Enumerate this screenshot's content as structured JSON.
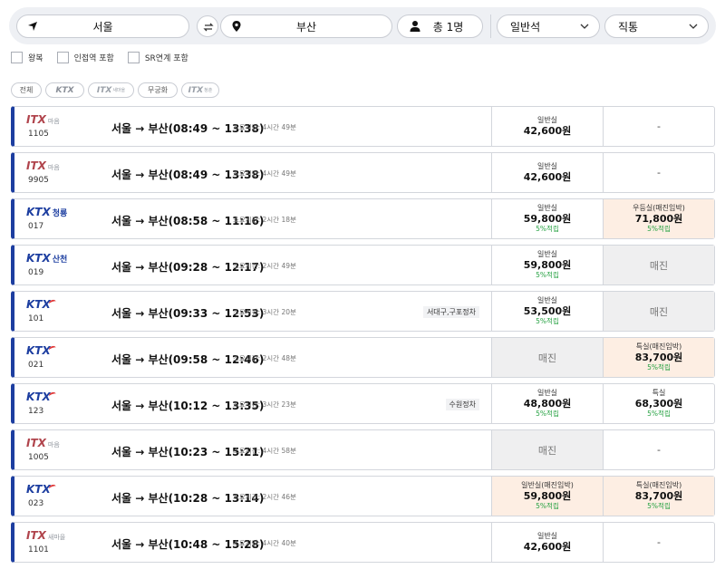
{
  "search": {
    "origin": "서울",
    "destination": "부산",
    "passengers": "총 1명",
    "seat_class": "일반석",
    "route_type": "직통"
  },
  "options": [
    {
      "label": "왕복"
    },
    {
      "label": "인접역 포함"
    },
    {
      "label": "SR연계 포함"
    }
  ],
  "filters": {
    "all": "전체",
    "ktx": "KTX",
    "itx_saemaeul_main": "ITX",
    "itx_saemaeul_sub": "새마을",
    "mugunghwa": "무궁화",
    "itx_cheongchun_main": "ITX",
    "itx_cheongchun_sub": "청춘"
  },
  "trains": [
    {
      "brand": "ITX",
      "brand_sub": "마음",
      "number": "1105",
      "route": "서울 → 부산(08:49 ~ 13:38)",
      "duration": "소요시간: 4시간 49분",
      "stop": "",
      "seat1": {
        "cls": "일반실",
        "price": "42,600원",
        "points": "",
        "status": "available"
      },
      "seat2": {
        "cls": "",
        "price": "",
        "points": "",
        "status": "none",
        "text": "-"
      }
    },
    {
      "brand": "ITX",
      "brand_sub": "마음",
      "number": "9905",
      "route": "서울 → 부산(08:49 ~ 13:38)",
      "duration": "소요시간: 4시간 49분",
      "stop": "",
      "seat1": {
        "cls": "일반실",
        "price": "42,600원",
        "points": "",
        "status": "available"
      },
      "seat2": {
        "cls": "",
        "price": "",
        "points": "",
        "status": "none",
        "text": "-"
      }
    },
    {
      "brand": "KTX",
      "brand_sub": "청룡",
      "number": "017",
      "route": "서울 → 부산(08:58 ~ 11:16)",
      "duration": "소요시간: 2시간 18분",
      "stop": "",
      "seat1": {
        "cls": "일반실",
        "price": "59,800원",
        "points": "5%적립",
        "status": "available"
      },
      "seat2": {
        "cls": "우등실(매진임박)",
        "price": "71,800원",
        "points": "5%적립",
        "status": "imminent"
      }
    },
    {
      "brand": "KTX",
      "brand_sub": "산천",
      "number": "019",
      "route": "서울 → 부산(09:28 ~ 12:17)",
      "duration": "소요시간: 2시간 49분",
      "stop": "",
      "seat1": {
        "cls": "일반실",
        "price": "59,800원",
        "points": "5%적립",
        "status": "available"
      },
      "seat2": {
        "cls": "",
        "price": "",
        "points": "",
        "status": "soldout",
        "text": "매진"
      }
    },
    {
      "brand": "KTX",
      "brand_sub": "",
      "number": "101",
      "route": "서울 → 부산(09:33 ~ 12:53)",
      "duration": "소요시간: 3시간 20분",
      "stop": "서대구,구포정차",
      "seat1": {
        "cls": "일반실",
        "price": "53,500원",
        "points": "5%적립",
        "status": "available"
      },
      "seat2": {
        "cls": "",
        "price": "",
        "points": "",
        "status": "soldout",
        "text": "매진"
      }
    },
    {
      "brand": "KTX",
      "brand_sub": "",
      "number": "021",
      "route": "서울 → 부산(09:58 ~ 12:46)",
      "duration": "소요시간: 2시간 48분",
      "stop": "",
      "seat1": {
        "cls": "",
        "price": "",
        "points": "",
        "status": "soldout",
        "text": "매진"
      },
      "seat2": {
        "cls": "특실(매진임박)",
        "price": "83,700원",
        "points": "5%적립",
        "status": "imminent"
      }
    },
    {
      "brand": "KTX",
      "brand_sub": "",
      "number": "123",
      "route": "서울 → 부산(10:12 ~ 13:35)",
      "duration": "소요시간: 3시간 23분",
      "stop": "수원정차",
      "seat1": {
        "cls": "일반실",
        "price": "48,800원",
        "points": "5%적립",
        "status": "available"
      },
      "seat2": {
        "cls": "특실",
        "price": "68,300원",
        "points": "5%적립",
        "status": "available"
      }
    },
    {
      "brand": "ITX",
      "brand_sub": "마음",
      "number": "1005",
      "route": "서울 → 부산(10:23 ~ 15:21)",
      "duration": "소요시간: 4시간 58분",
      "stop": "",
      "seat1": {
        "cls": "",
        "price": "",
        "points": "",
        "status": "soldout",
        "text": "매진"
      },
      "seat2": {
        "cls": "",
        "price": "",
        "points": "",
        "status": "none",
        "text": "-"
      }
    },
    {
      "brand": "KTX",
      "brand_sub": "",
      "number": "023",
      "route": "서울 → 부산(10:28 ~ 13:14)",
      "duration": "소요시간: 2시간 46분",
      "stop": "",
      "seat1": {
        "cls": "일반실(매진임박)",
        "price": "59,800원",
        "points": "5%적립",
        "status": "imminent"
      },
      "seat2": {
        "cls": "특실(매진임박)",
        "price": "83,700원",
        "points": "5%적립",
        "status": "imminent"
      }
    },
    {
      "brand": "ITX",
      "brand_sub": "새마을",
      "number": "1101",
      "route": "서울 → 부산(10:48 ~ 15:28)",
      "duration": "소요시간: 4시간 40분",
      "stop": "",
      "seat1": {
        "cls": "일반실",
        "price": "42,600원",
        "points": "",
        "status": "available"
      },
      "seat2": {
        "cls": "",
        "price": "",
        "points": "",
        "status": "none",
        "text": "-"
      }
    }
  ],
  "colors": {
    "accent_blue": "#1d3ea0",
    "imminent_bg": "#fdeee3",
    "soldout_bg": "#efeff0",
    "points_green": "#27a243"
  }
}
